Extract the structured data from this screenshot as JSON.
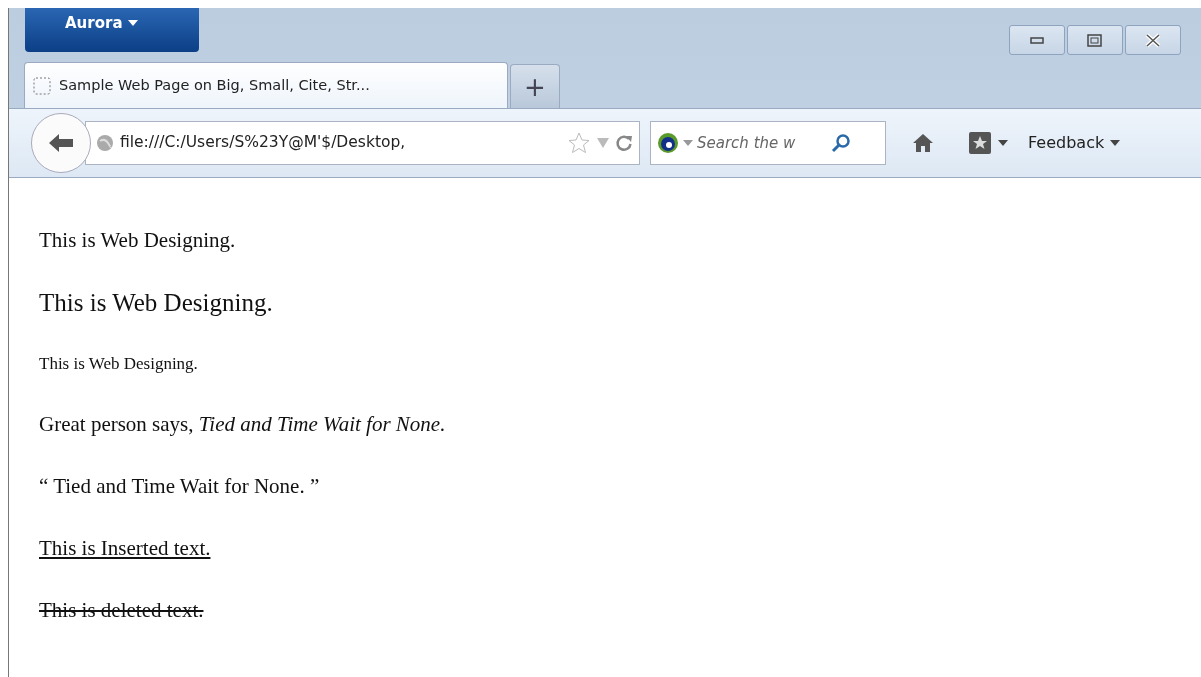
{
  "window": {
    "app_menu": "Aurora"
  },
  "tabs": [
    {
      "title": "Sample Web Page on Big, Small, Cite, Str...",
      "selected": true
    }
  ],
  "new_tab": "+",
  "navbar": {
    "url": "file:///C:/Users/S%23Y@M'$/Desktop,",
    "search_placeholder": "Search the w",
    "feedback": "Feedback"
  },
  "content": [
    {
      "kind": "normal",
      "text": "This is Web Designing."
    },
    {
      "kind": "big",
      "text": "This is Web Designing."
    },
    {
      "kind": "small",
      "text": "This is Web Designing."
    },
    {
      "kind": "rich",
      "text": "Great person says, *Tied and Time Wait for None.*"
    },
    {
      "kind": "normal",
      "text": "“ Tied and Time Wait for None. ”"
    },
    {
      "kind": "inserted",
      "text": "This is Inserted text."
    },
    {
      "kind": "deleted",
      "text": "This is deleted text."
    }
  ]
}
